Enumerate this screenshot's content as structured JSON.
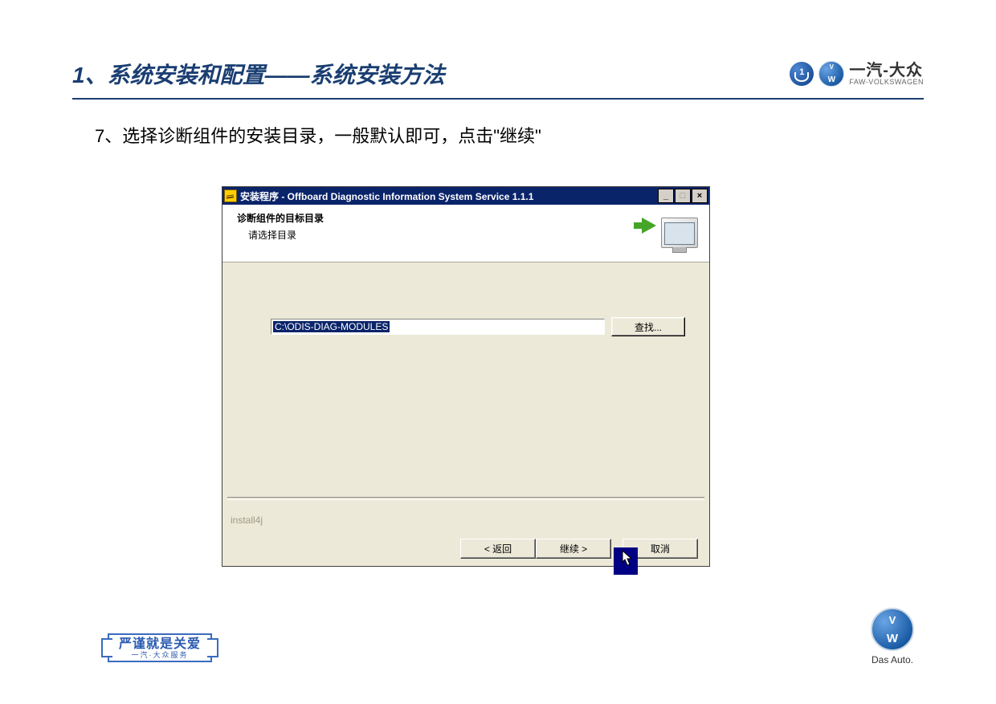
{
  "slide": {
    "title": "1、系统安装和配置——系统安装方法",
    "step_text": "7、选择诊断组件的安装目录，一般默认即可，点击\"继续\""
  },
  "brand": {
    "cn": "一汽-大众",
    "en": "FAW-VOLKSWAGEN",
    "das_auto": "Das Auto."
  },
  "service_badge": {
    "line1": "严谨就是关爱",
    "line2": "一汽·大众服务"
  },
  "installer": {
    "title": "安装程序 - Offboard Diagnostic Information System Service 1.1.1",
    "heading": "诊断组件的目标目录",
    "subheading": "请选择目录",
    "path": "C:\\ODIS-DIAG-MODULES",
    "browse": "查找...",
    "watermark": "install4j",
    "buttons": {
      "back": "< 返回",
      "next": "继续 >",
      "cancel": "取消"
    },
    "titlebar": {
      "min": "_",
      "max": "□",
      "close": "×"
    }
  }
}
